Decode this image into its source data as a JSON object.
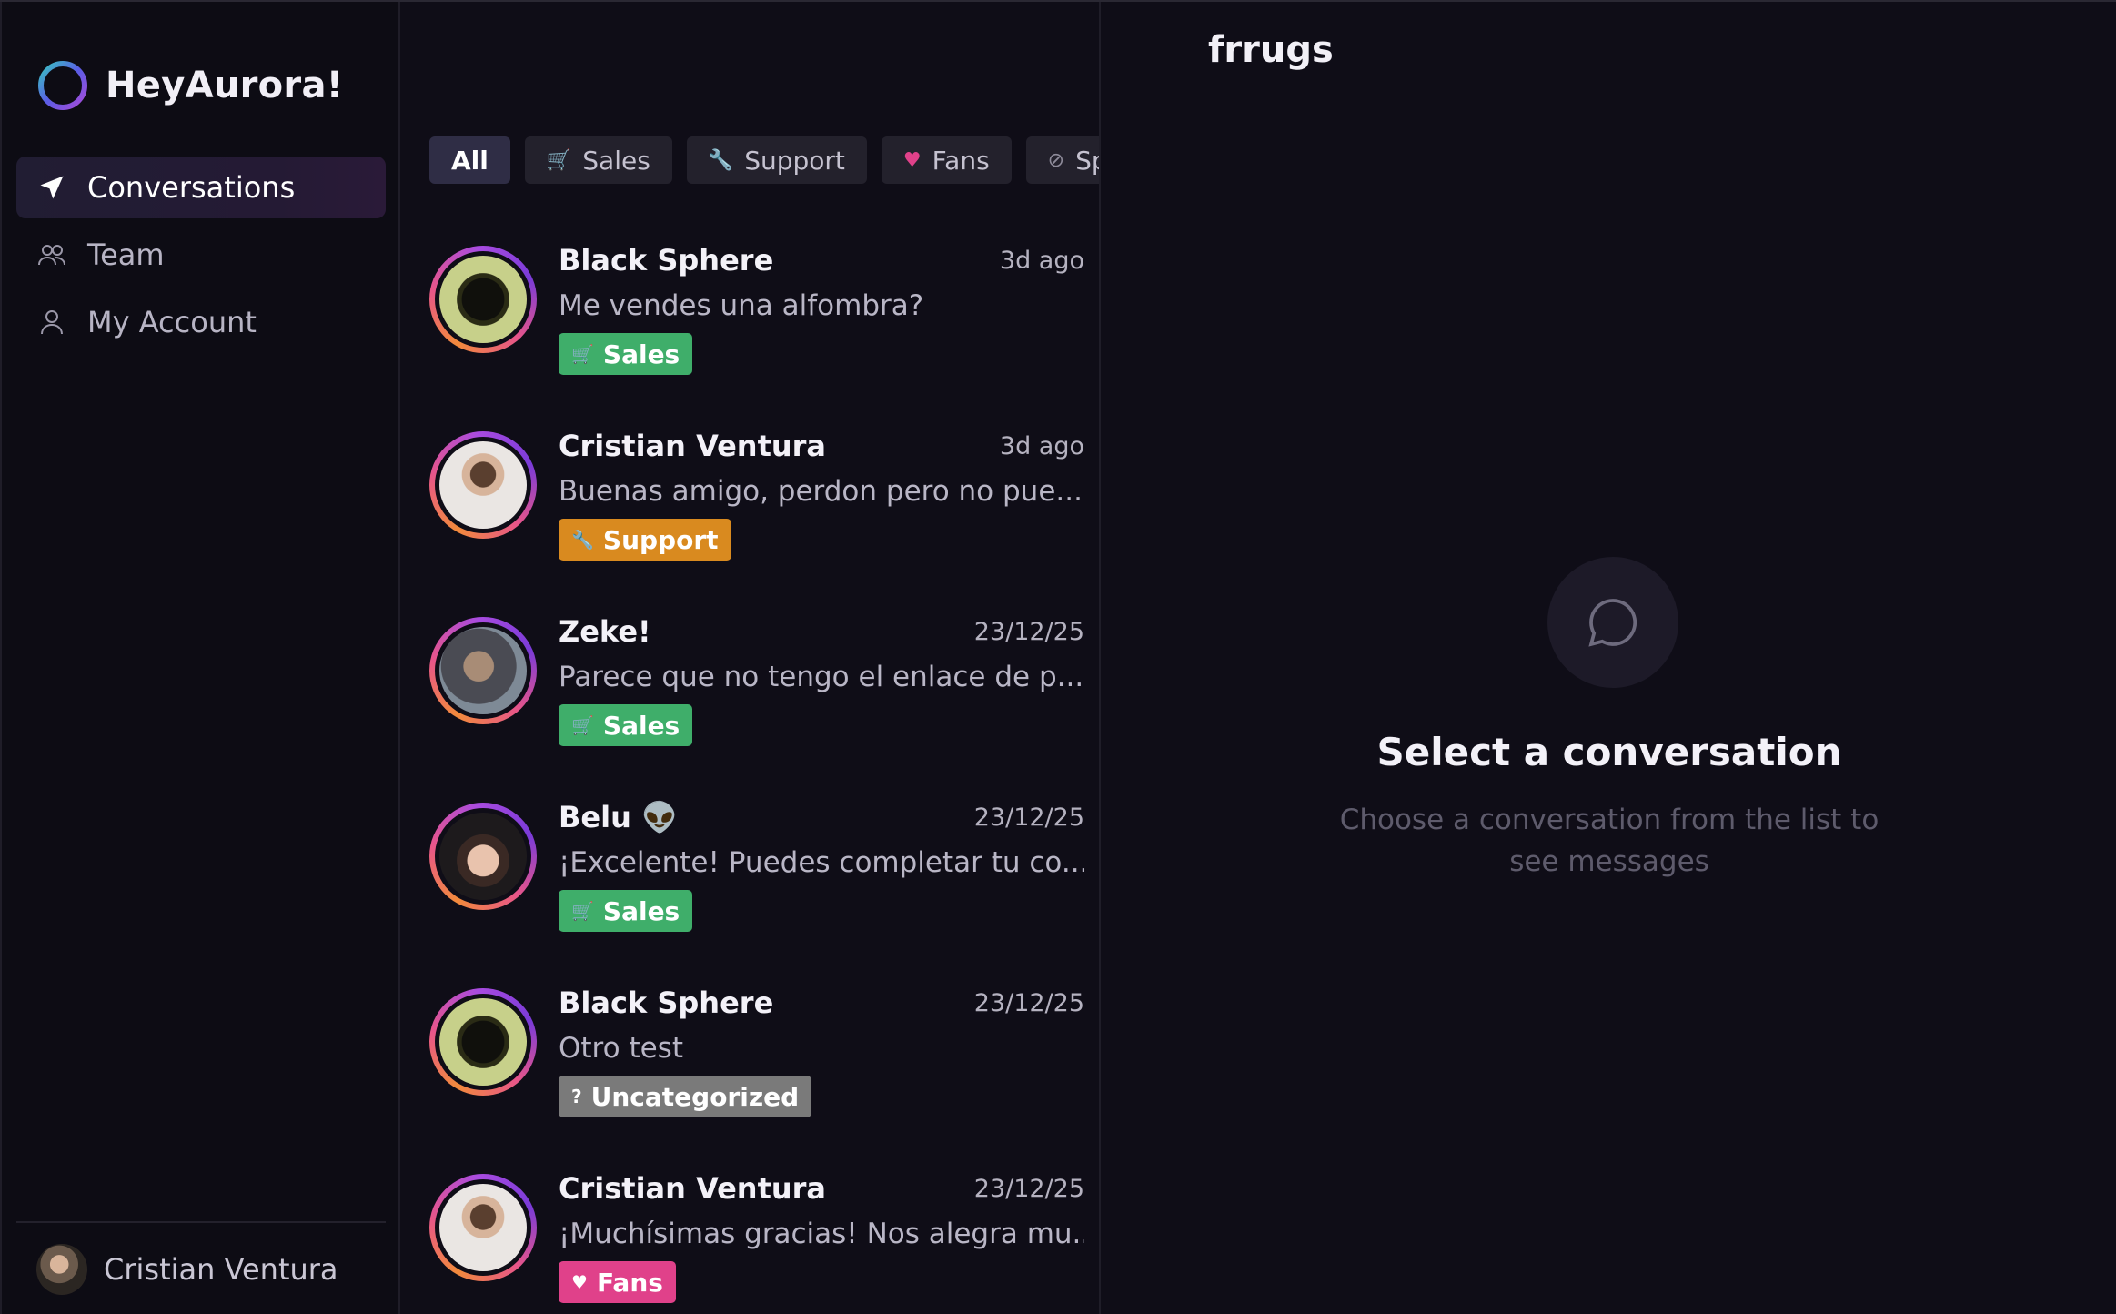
{
  "brand": {
    "name": "HeyAurora!"
  },
  "header": {
    "title": "frrugs"
  },
  "nav": {
    "items": [
      {
        "label": "Conversations",
        "icon": "send-icon",
        "active": true
      },
      {
        "label": "Team",
        "icon": "team-icon",
        "active": false
      },
      {
        "label": "My Account",
        "icon": "user-icon",
        "active": false
      }
    ]
  },
  "footer": {
    "user_name": "Cristian Ventura"
  },
  "filters": [
    {
      "label": "All",
      "icon": "",
      "active": true
    },
    {
      "label": "Sales",
      "icon": "cart-icon"
    },
    {
      "label": "Support",
      "icon": "wrench-icon"
    },
    {
      "label": "Fans",
      "icon": "heart-icon"
    },
    {
      "label": "Spa",
      "icon": "spam-icon"
    }
  ],
  "conversations": [
    {
      "name": "Black Sphere",
      "time": "3d ago",
      "snippet": "Me vendes una alfombra?",
      "tag": "Sales",
      "tag_icon": "🛒",
      "tag_color": "#3fae6a"
    },
    {
      "name": "Cristian Ventura",
      "time": "3d ago",
      "snippet": "Buenas amigo, perdon pero no pue...",
      "tag": "Support",
      "tag_icon": "🔧",
      "tag_color": "#d98a1f"
    },
    {
      "name": "Zeke!",
      "time": "23/12/25",
      "snippet": "Parece que no tengo el enlace de p...",
      "tag": "Sales",
      "tag_icon": "🛒",
      "tag_color": "#3fae6a"
    },
    {
      "name": "Belu 👽",
      "time": "23/12/25",
      "snippet": "¡Excelente! Puedes completar tu co...",
      "tag": "Sales",
      "tag_icon": "🛒",
      "tag_color": "#3fae6a"
    },
    {
      "name": "Black Sphere",
      "time": "23/12/25",
      "snippet": "Otro test",
      "tag": "Uncategorized",
      "tag_icon": "?",
      "tag_color": "#7a7a7a"
    },
    {
      "name": "Cristian Ventura",
      "time": "23/12/25",
      "snippet": "¡Muchísimas gracias! Nos alegra mu...",
      "tag": "Fans",
      "tag_icon": "♥",
      "tag_color": "#e0418a"
    }
  ],
  "empty_state": {
    "title": "Select a conversation",
    "subtitle": "Choose a conversation from the list to see messages",
    "icon": "chat-bubble-icon"
  }
}
